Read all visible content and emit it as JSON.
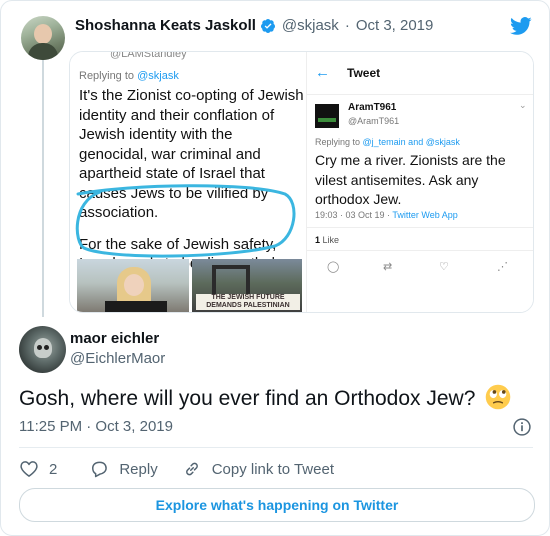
{
  "parent_tweet": {
    "author_name": "Shoshanna Keats Jaskoll",
    "author_handle": "@skjask",
    "date": "Oct 3, 2019",
    "screenshot_left": {
      "handle_top": "@LAMStandley",
      "replying_prefix": "Replying to ",
      "replying_handle": "@skjask",
      "para1": "It's the Zionist co-opting of Jewish identity and their conflation of Jewish identity with the genocidal, war criminal and apartheid state of Israel that causes Jews to be vilified by association.",
      "para2": "For the sake of Jewish safety, Israel needs to be dismantled.",
      "sign_text": "THE JEWISH FUTURE DEMANDS PALESTINIAN FREEDOM"
    },
    "screenshot_right": {
      "back_icon": "back-arrow-icon",
      "title": "Tweet",
      "user_name": "AramT961",
      "user_handle": "@AramT961",
      "replying_prefix": "Replying to ",
      "replying_handles": "@j_temain and @skjask",
      "body": "Cry me a river. Zionists are the vilest antisemites. Ask any orthodox Jew.",
      "meta_time": "19:03 · 03 Oct 19 · ",
      "meta_source": "Twitter Web App",
      "likes_count": "1",
      "likes_label": " Like"
    }
  },
  "reply_tweet": {
    "author_name": "maor eichler",
    "author_handle": "@EichlerMaor",
    "text": "Gosh, where will you ever find an Orthodox Jew?",
    "emoji": "face-with-rolling-eyes",
    "timestamp": "11:25 PM · Oct 3, 2019",
    "likes": "2",
    "reply_label": "Reply",
    "copy_link_label": "Copy link to Tweet"
  },
  "footer": {
    "explore_label": "Explore what's happening on Twitter"
  },
  "colors": {
    "twitter_blue": "#1d9bf0",
    "text_primary": "#0f1419",
    "text_secondary": "#536471",
    "border": "#e1e8ed"
  }
}
